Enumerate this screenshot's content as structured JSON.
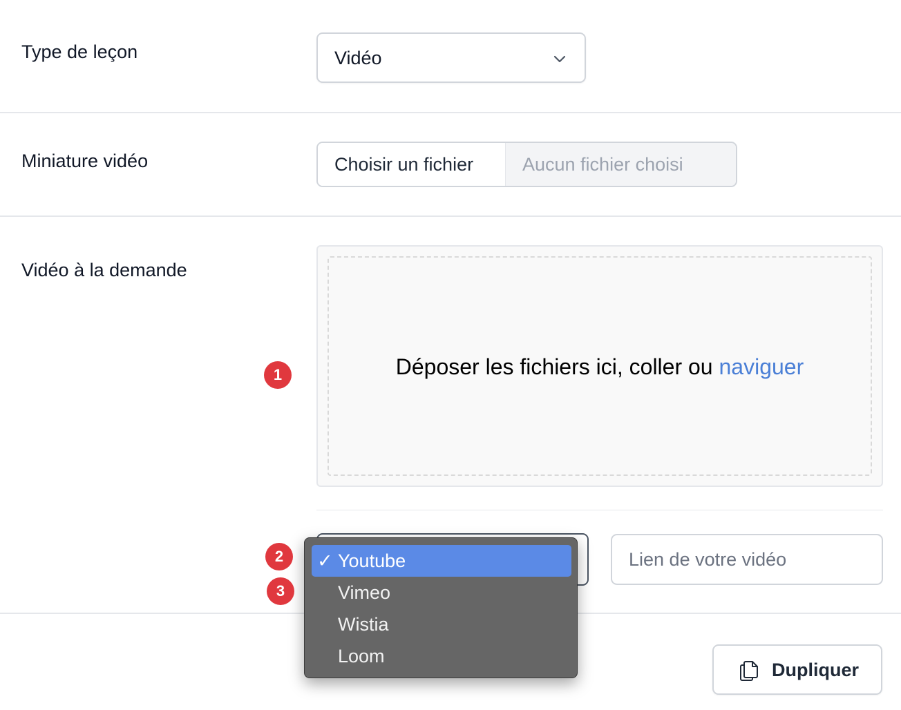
{
  "lesson_type": {
    "label": "Type de leçon",
    "selected": "Vidéo",
    "icon": "chevron-down-icon"
  },
  "thumbnail": {
    "label": "Miniature vidéo",
    "button": "Choisir un fichier",
    "status": "Aucun fichier choisi"
  },
  "vod": {
    "label": "Vidéo à la demande",
    "drop_text": "Déposer les fichiers ici, coller ou",
    "drop_link": "naviguer",
    "url_placeholder": "Lien de votre vidéo"
  },
  "source_menu": {
    "check": "✓",
    "options": [
      "Youtube",
      "Vimeo",
      "Wistia",
      "Loom"
    ],
    "selected": "Youtube"
  },
  "badges": [
    "1",
    "2",
    "3"
  ],
  "footer": {
    "duplicate_label": "Dupliquer",
    "duplicate_icon": "copy-icon"
  },
  "colors": {
    "link": "#4a7fd6",
    "menu_highlight": "#5b8ae6",
    "badge": "#e0383e"
  }
}
